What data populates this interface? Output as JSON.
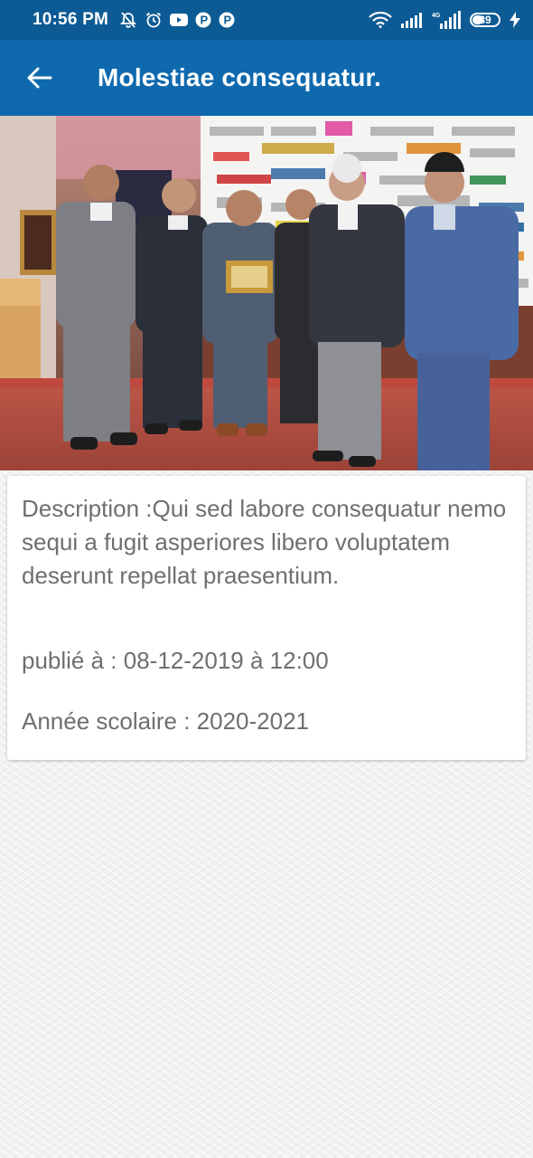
{
  "status_bar": {
    "time": "10:56 PM",
    "battery_level": "39",
    "icons": [
      "mute-bell-icon",
      "alarm-icon",
      "youtube-icon",
      "p-app-icon",
      "p-app-icon",
      "wifi-icon",
      "signal-icon",
      "4g-signal-icon",
      "battery-icon",
      "charging-bolt-icon"
    ]
  },
  "app_bar": {
    "title": "Molestiae consequatur."
  },
  "photo": {
    "description_alt": ""
  },
  "details": {
    "description": "Description :Qui sed labore consequatur nemo sequi a fugit asperiores libero voluptatem deserunt repellat praesentium.",
    "published": "publié à : 08-12-2019 à 12:00",
    "school_year": "Année scolaire : 2020-2021"
  },
  "colors": {
    "status_bar": "#0d5b94",
    "app_bar": "#0e69ad",
    "card_text": "#6f6f6f"
  }
}
